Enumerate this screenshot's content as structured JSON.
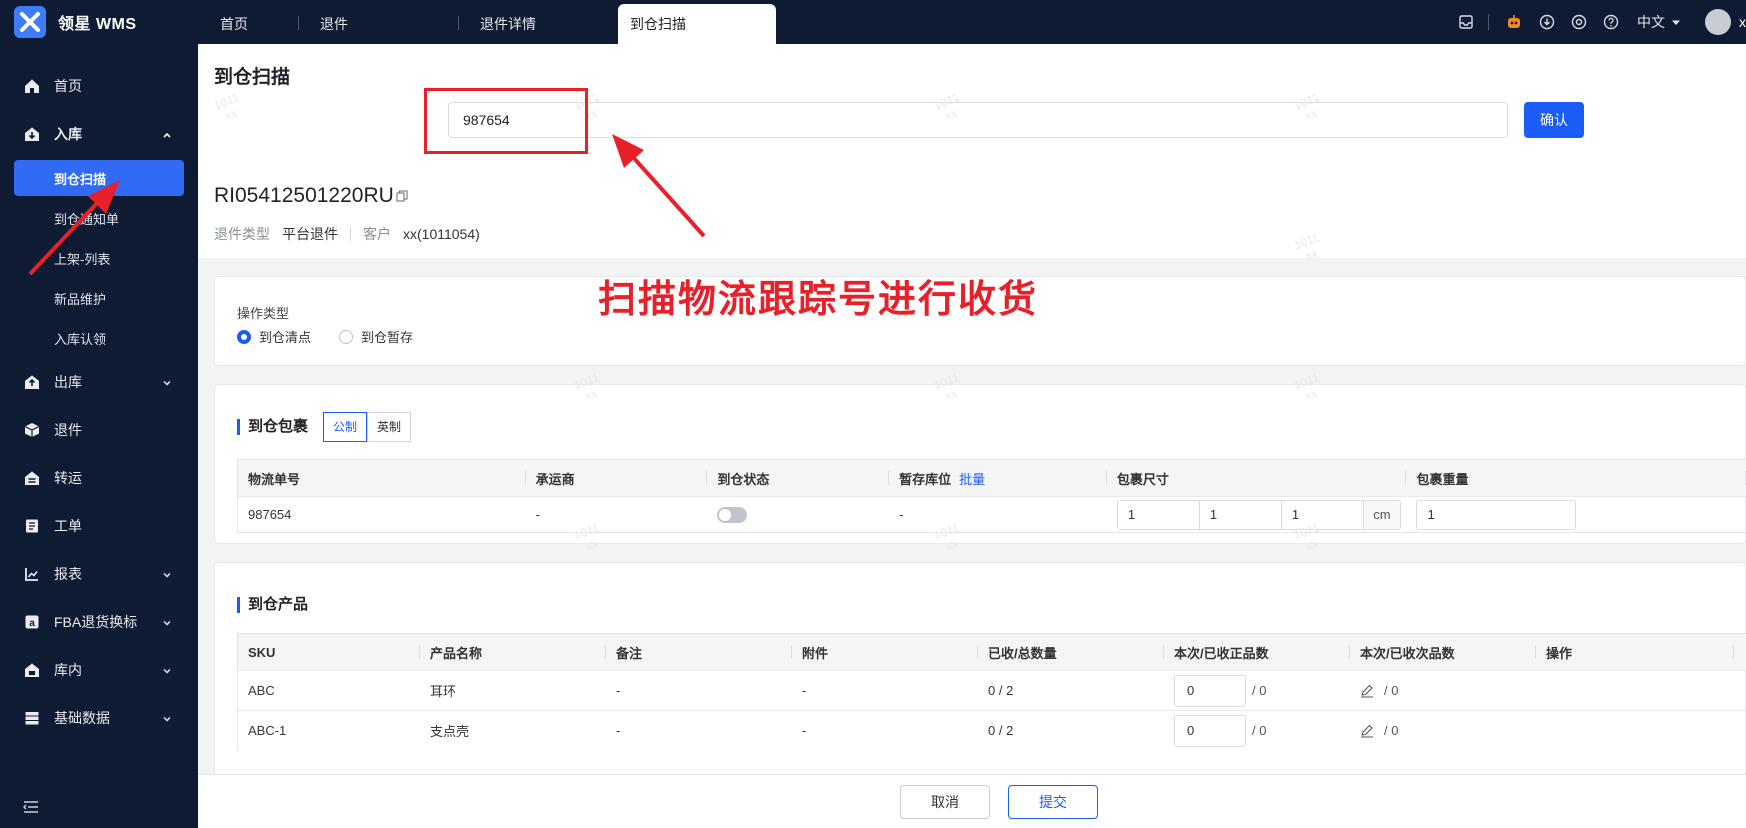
{
  "app": {
    "name": "领星 WMS"
  },
  "tabs": [
    {
      "label": "首页"
    },
    {
      "label": "退件"
    },
    {
      "label": "退件详情"
    },
    {
      "label": "到仓扫描"
    }
  ],
  "topbar": {
    "lang": "中文",
    "user": "x"
  },
  "sidebar": {
    "items": [
      {
        "label": "首页",
        "icon": "home-icon"
      },
      {
        "label": "入库",
        "icon": "inbound-icon",
        "expanded": true,
        "children": [
          "到仓扫描",
          "到仓通知单",
          "上架-列表",
          "新品维护",
          "入库认领"
        ]
      },
      {
        "label": "出库",
        "icon": "outbound-icon"
      },
      {
        "label": "退件",
        "icon": "return-icon"
      },
      {
        "label": "转运",
        "icon": "transfer-icon"
      },
      {
        "label": "工单",
        "icon": "workorder-icon"
      },
      {
        "label": "报表",
        "icon": "report-icon"
      },
      {
        "label": "FBA退货换标",
        "icon": "amazon-icon"
      },
      {
        "label": "库内",
        "icon": "warehouse-icon"
      },
      {
        "label": "基础数据",
        "icon": "data-icon"
      }
    ]
  },
  "page": {
    "title": "到仓扫描",
    "scan_value": "987654",
    "confirm_label": "确认",
    "annotation": "扫描物流跟踪号进行收货",
    "order_no": "RI05412501220RU",
    "meta": {
      "type_key": "退件类型",
      "type_val": "平台退件",
      "customer_key": "客户",
      "customer_val": "xx(1011054)"
    },
    "ops": {
      "label": "操作类型",
      "options": [
        "到仓清点",
        "到仓暂存"
      ],
      "selected": 0
    },
    "packages": {
      "title": "到仓包裹",
      "units": [
        "公制",
        "英制"
      ],
      "columns": [
        "物流单号",
        "承运商",
        "到仓状态",
        "暂存库位",
        "包裹尺寸",
        "包裹重量"
      ],
      "batch_link": "批量",
      "rows": [
        {
          "tracking": "987654",
          "carrier": "-",
          "location": "-",
          "l": "1",
          "w": "1",
          "h": "1",
          "dim_unit": "cm",
          "weight": "1"
        }
      ]
    },
    "products": {
      "title": "到仓产品",
      "columns": [
        "SKU",
        "产品名称",
        "备注",
        "附件",
        "已收/总数量",
        "本次/已收正品数",
        "本次/已收次品数",
        "操作"
      ],
      "rows": [
        {
          "sku": "ABC",
          "name": "耳环",
          "note": "-",
          "attach": "-",
          "recv": "0 / 2",
          "good": "0",
          "good_recv": "/ 0",
          "bad_recv": "/ 0"
        },
        {
          "sku": "ABC-1",
          "name": "支点壳",
          "note": "-",
          "attach": "-",
          "recv": "0 / 2",
          "good": "0",
          "good_recv": "/ 0",
          "bad_recv": "/ 0"
        }
      ]
    },
    "footer": {
      "cancel": "取消",
      "submit": "提交"
    }
  },
  "watermark": {
    "line1": "1011",
    "line2": "xx"
  },
  "colors": {
    "sidebar_bg": "#0f1b33",
    "primary": "#1a5cf5",
    "annotation": "#e8202a"
  }
}
